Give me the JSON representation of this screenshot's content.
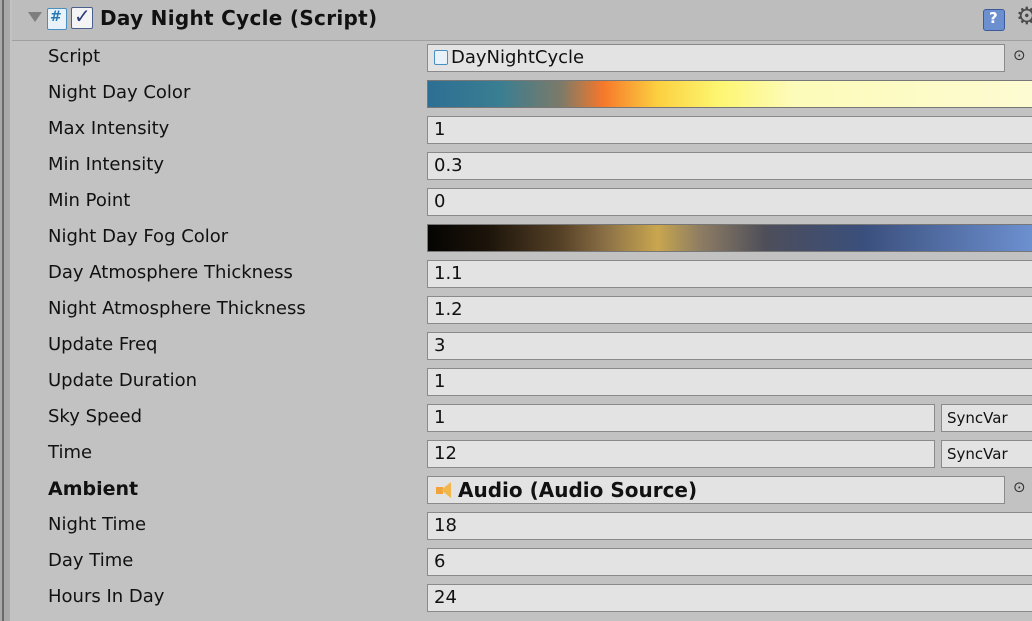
{
  "header": {
    "title": "Day Night Cycle (Script)",
    "enabled": true,
    "icons": [
      "foldout-arrow-icon",
      "csharp-script-icon",
      "help-icon",
      "gear-icon"
    ]
  },
  "fields": {
    "script": {
      "label": "Script",
      "value": "DayNightCycle"
    },
    "night_day_color": {
      "label": "Night Day Color"
    },
    "max_intensity": {
      "label": "Max Intensity",
      "value": "1"
    },
    "min_intensity": {
      "label": "Min Intensity",
      "value": "0.3"
    },
    "min_point": {
      "label": "Min Point",
      "value": "0"
    },
    "night_day_fog_color": {
      "label": "Night Day Fog Color"
    },
    "day_atmosphere_thickness": {
      "label": "Day Atmosphere Thickness",
      "value": "1.1"
    },
    "night_atmosphere_thickness": {
      "label": "Night Atmosphere Thickness",
      "value": "1.2"
    },
    "update_freq": {
      "label": "Update Freq",
      "value": "3"
    },
    "update_duration": {
      "label": "Update Duration",
      "value": "1"
    },
    "sky_speed": {
      "label": "Sky Speed",
      "value": "1",
      "tag": "SyncVar"
    },
    "time": {
      "label": "Time",
      "value": "12",
      "tag": "SyncVar"
    },
    "ambient": {
      "label": "Ambient",
      "value": "Audio (Audio Source)"
    },
    "night_time": {
      "label": "Night Time",
      "value": "18"
    },
    "day_time": {
      "label": "Day Time",
      "value": "6"
    },
    "hours_in_day": {
      "label": "Hours In Day",
      "value": "24"
    }
  },
  "colors": {
    "background": "#c2c2c2",
    "field_background": "#e3e3e3",
    "accent": "#4a8fc2"
  }
}
